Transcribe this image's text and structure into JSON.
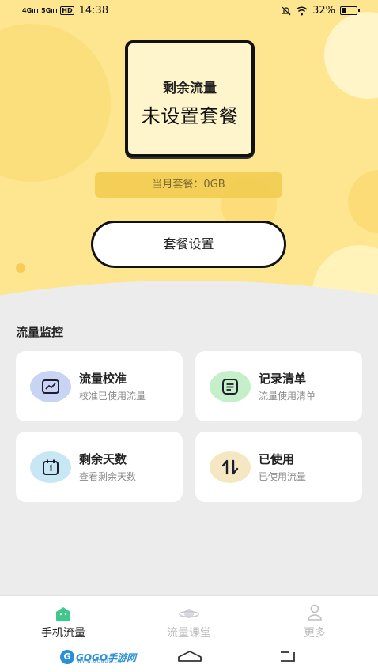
{
  "status_bar": {
    "signal_1": "4G",
    "signal_2": "5G",
    "hd": "HD",
    "time": "14:38",
    "battery": "32%"
  },
  "card": {
    "title": "剩余流量",
    "value": "未设置套餐"
  },
  "plan_info": "当月套餐：0GB",
  "plan_button": "套餐设置",
  "monitor": {
    "title": "流量监控",
    "tiles": [
      {
        "title": "流量校准",
        "subtitle": "校准已使用流量",
        "icon": "chart-icon",
        "color": "#c9d4f5"
      },
      {
        "title": "记录清单",
        "subtitle": "流量使用清单",
        "icon": "list-icon",
        "color": "#c5efc8"
      },
      {
        "title": "剩余天数",
        "subtitle": "查看剩余天数",
        "icon": "calendar-icon",
        "color": "#c7e7f5"
      },
      {
        "title": "已使用",
        "subtitle": "已使用流量",
        "icon": "transfer-icon",
        "color": "#f6e7c3"
      }
    ]
  },
  "nav": {
    "items": [
      {
        "label": "手机流量",
        "icon": "home-icon",
        "active": true
      },
      {
        "label": "流量课堂",
        "icon": "planet-icon",
        "active": false
      },
      {
        "label": "更多",
        "icon": "profile-icon",
        "active": false
      }
    ]
  },
  "watermark": {
    "text": "GOGO手游网",
    "url": "WWW.GOGOO.CN"
  },
  "colors": {
    "hero": "#fde68f",
    "accent_green": "#3ec98a"
  }
}
